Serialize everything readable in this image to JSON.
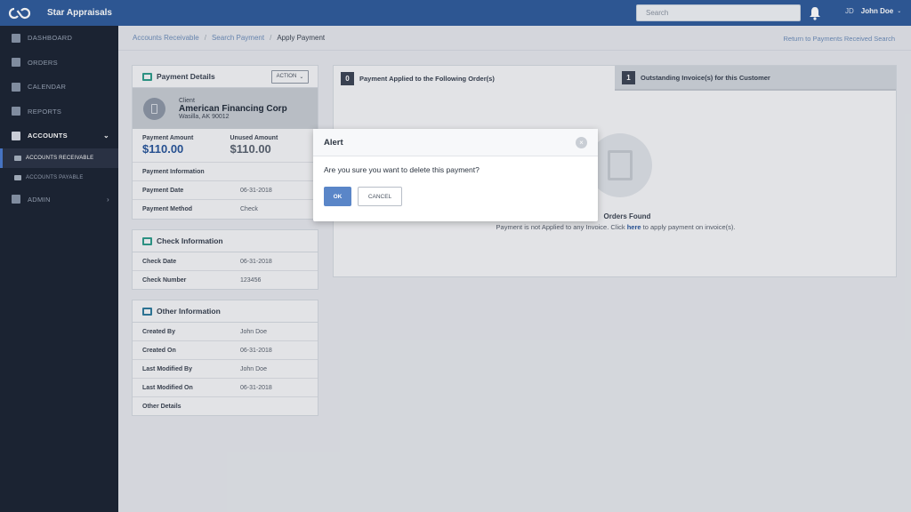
{
  "app": {
    "title": "Star Appraisals",
    "logo": "infinity-logo"
  },
  "topbar": {
    "search_placeholder": "Search",
    "bell_icon": "bell-icon",
    "user_initials": "JD",
    "user_name": "John Doe",
    "user_caret": "⌄"
  },
  "sidebar": {
    "items": [
      {
        "label": "DASHBOARD",
        "icon": "dashboard-icon"
      },
      {
        "label": "ORDERS",
        "icon": "list-icon"
      },
      {
        "label": "CALENDAR",
        "icon": "calendar-icon"
      },
      {
        "label": "REPORTS",
        "icon": "report-icon"
      },
      {
        "label": "ACCOUNTS",
        "icon": "briefcase-icon",
        "chevron": "⌄"
      },
      {
        "label": "ADMIN",
        "icon": "user-icon",
        "chevron": "›"
      }
    ],
    "sub_items": [
      {
        "label": "ACCOUNTS RECEIVABLE"
      },
      {
        "label": "ACCOUNTS PAYABLE"
      }
    ]
  },
  "breadcrumb": {
    "items": [
      "Accounts Receivable",
      "Search Payment"
    ],
    "separator": "/",
    "current": "Apply Payment",
    "return_link": "Return to Payments Received Search"
  },
  "payment_details": {
    "title": "Payment Details",
    "action_label": "ACTION",
    "client_label": "Client",
    "client_name": "American Financing Corp",
    "client_address": "Wasilla, AK 90012",
    "payment_amount_label": "Payment Amount",
    "payment_amount": "$110.00",
    "unused_amount_label": "Unused Amount",
    "unused_amount": "$110.00",
    "info_label": "Payment Information",
    "rows": [
      {
        "label": "Payment Date",
        "value": "06-31-2018"
      },
      {
        "label": "Payment Method",
        "value": "Check"
      }
    ]
  },
  "check_information": {
    "title": "Check Information",
    "rows": [
      {
        "label": "Check Date",
        "value": "06-31-2018"
      },
      {
        "label": "Check Number",
        "value": "123456"
      }
    ]
  },
  "other_information": {
    "title": "Other Information",
    "rows": [
      {
        "label": "Created By",
        "value": "John Doe"
      },
      {
        "label": "Created On",
        "value": "06-31-2018"
      },
      {
        "label": "Last Modified By",
        "value": "John Doe"
      },
      {
        "label": "Last Modified On",
        "value": "06-31-2018"
      },
      {
        "label": "Other Details",
        "value": ""
      }
    ]
  },
  "right_panel": {
    "tab1": {
      "count": "0",
      "label": "Payment Applied to the Following Order(s)"
    },
    "tab2": {
      "count": "1",
      "label": "Outstanding Invoice(s) for this Customer"
    },
    "empty_title": "Orders Found",
    "empty_msg_before": "Payment is not Applied to any Invoice. Click ",
    "empty_msg_link": "here",
    "empty_msg_after": " to apply payment on invoice(s)."
  },
  "modal": {
    "title": "Alert",
    "close_glyph": "×",
    "message": "Are you sure you want to delete this payment?",
    "ok_label": "OK",
    "cancel_label": "CANCEL"
  },
  "colors": {
    "topbar": "#2f5c9c",
    "sidebar": "#1c2433",
    "accent": "#5a86c8",
    "amount": "#28559a"
  }
}
